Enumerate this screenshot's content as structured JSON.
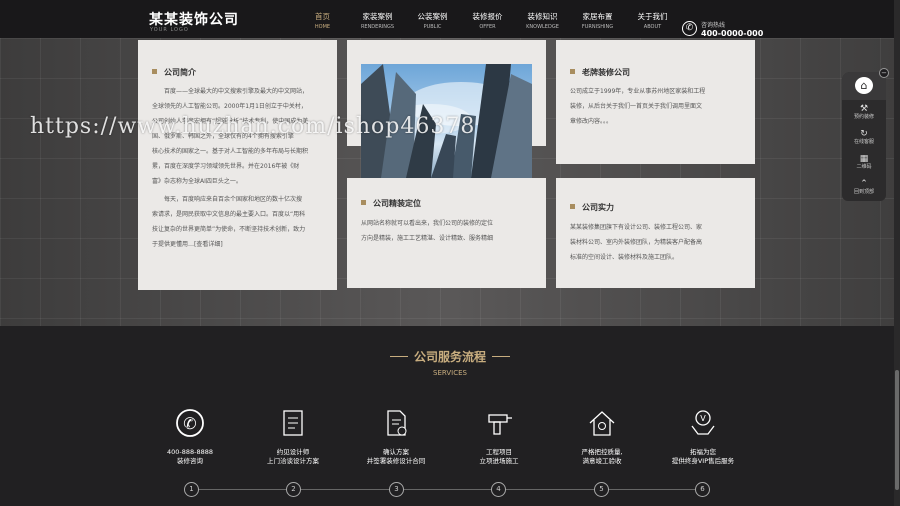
{
  "header": {
    "logo": "某某装饰公司",
    "logo_sub": "YOUR LOGO",
    "nav": [
      {
        "cn": "首页",
        "en": "HOME",
        "active": true
      },
      {
        "cn": "家装案例",
        "en": "RENDERINGS"
      },
      {
        "cn": "公装案例",
        "en": "PUBLIC"
      },
      {
        "cn": "装修报价",
        "en": "OFFER"
      },
      {
        "cn": "装修知识",
        "en": "KNOWLEDGE"
      },
      {
        "cn": "家居布置",
        "en": "FURNISHING"
      },
      {
        "cn": "关于我们",
        "en": "ABOUT"
      }
    ],
    "hotline_label": "咨询热线",
    "hotline_number": "400-0000-000"
  },
  "about": {
    "intro_title": "公司简介",
    "intro_text": [
      "百度——全球最大的中文搜索引擎及最大的中文网站，",
      "全球领先的人工智能公司。2000年1月1日创立于中关村，",
      "公司创始人李彦宏拥有“超链分析”技术专利，使中国成为美",
      "国、俄罗斯、韩国之外，全球仅有的4个拥有搜索引擎",
      "核心技术的国家之一。基于对人工智能的多年布局与长期积",
      "累，百度在深度学习领域领先世界。并在2016年被《财",
      "富》杂志称为全球AI四巨头之一。",
      "每天，百度响应来自百余个国家和地区的数十亿次搜",
      "索请求，是网民获取中文信息的最主要入口。百度以“用科",
      "技让复杂的世界更简单”为使命，不断坚持技术创新，致力",
      "于提供更懂用…[查看详细]"
    ],
    "positioning_title": "公司精装定位",
    "positioning_text": [
      "从网站名称就可以看出来，我们公司的装修的定位",
      "方向是精装，施工工艺精湛、设计精致、服务精细"
    ],
    "brand_title": "老牌装修公司",
    "brand_text": [
      "公司成立于1999年，专业从事苏州地区家装和工程",
      "装修，从后台关于我们一首页关于我们调用里面文",
      "章修改内容。。。"
    ],
    "strength_title": "公司实力",
    "strength_text": [
      "某某装修集团旗下有设计公司、装修工程公司、家",
      "装材料公司、室内外装修团队，为精装客户配备高",
      "标准的空间设计、装修材料及施工团队。"
    ]
  },
  "watermark": "https://www.huzhan.com/ishop46378",
  "float_bar": {
    "close": "−",
    "items": [
      {
        "icon": "tool-icon",
        "label": "预约装修"
      },
      {
        "icon": "refresh-icon",
        "label": "在线客服"
      },
      {
        "icon": "qrcode-icon",
        "label": "二维码"
      },
      {
        "icon": "up-icon",
        "label": "回到顶部"
      }
    ]
  },
  "services": {
    "title": "公司服务流程",
    "subtitle": "SERVICES",
    "steps": [
      {
        "num": "1",
        "line1": "400-888-8888",
        "line2": "装修咨询"
      },
      {
        "num": "2",
        "line1": "约见设计师",
        "line2": "上门洽谈设计方案"
      },
      {
        "num": "3",
        "line1": "确认方案",
        "line2": "并签署装修设计合同"
      },
      {
        "num": "4",
        "line1": "工程项目",
        "line2": "立项进场施工"
      },
      {
        "num": "5",
        "line1": "严格把控质量,",
        "line2": "满意竣工验收"
      },
      {
        "num": "6",
        "line1": "拓福为您",
        "line2": "提供终身VIP售后服务"
      }
    ]
  },
  "colors": {
    "accent": "#c8ad7f",
    "dark": "#1f1e20",
    "card": "#ebe9e7"
  }
}
